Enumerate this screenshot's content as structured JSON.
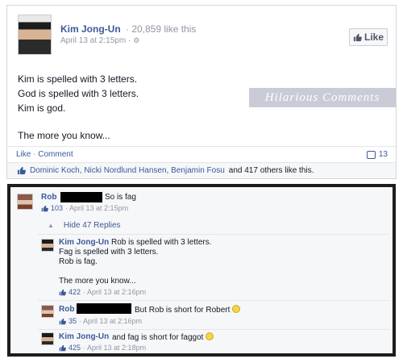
{
  "post": {
    "author": "Kim Jong-Un",
    "likes_count": "· 20,859 like this",
    "timestamp": "April 13 at 2:15pm ·",
    "like_button": "Like",
    "lines": [
      "Kim is spelled with 3 letters.",
      "God is spelled with 3 letters.",
      "Kim is god.",
      "The more you know..."
    ],
    "watermark": "Hilarious Comments",
    "action_like": "Like",
    "action_comment": "Comment",
    "comment_count": "13",
    "likers_names": "Dominic Koch, Nicki Nordlund Hansen, Benjamin Fosu",
    "likers_rest": "and 417 others like this."
  },
  "comments": {
    "c1": {
      "author": "Rob",
      "text": "So is fag",
      "likes": "103",
      "time": "· April 13 at 2:15pm"
    },
    "hide_replies": "Hide 47 Replies",
    "r1": {
      "author": "Kim Jong-Un",
      "lines": [
        "Rob is spelled with 3 letters.",
        "Fag is spelled with 3 letters.",
        "Rob is fag.",
        "The more you know..."
      ],
      "likes": "422",
      "time": "· April 13 at 2:16pm"
    },
    "r2": {
      "author": "Rob",
      "text": "But Rob is short for Robert",
      "likes": "35",
      "time": "· April 13 at 2:16pm"
    },
    "r3": {
      "author": "Kim Jong-Un",
      "text": "and fag is short for faggot",
      "likes": "425",
      "time": "· April 13 at 2:18pm"
    }
  },
  "colors": {
    "link": "#3b5998",
    "meta": "#9197a3",
    "frame": "#1d1d1d",
    "panel": "#f6f7f9"
  }
}
